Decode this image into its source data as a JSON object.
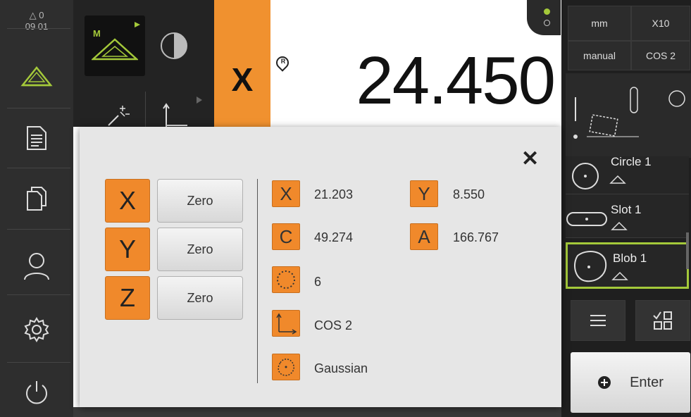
{
  "sidebar": {
    "warnings_count": "0",
    "time": "09 01",
    "items": [
      {
        "icon": "measure-triangle-icon"
      },
      {
        "icon": "document-list-icon"
      },
      {
        "icon": "files-icon"
      },
      {
        "icon": "user-icon"
      },
      {
        "icon": "settings-gear-icon"
      },
      {
        "icon": "power-icon"
      }
    ]
  },
  "toolbar": {
    "mode_badge": "M",
    "contrast_icon": "contrast-icon",
    "auto_icon": "magic-wand-icon",
    "coord_icon": "coordinate-axes-icon"
  },
  "dro": {
    "axis": "X",
    "ref_marker": "R",
    "value": "24.450"
  },
  "rightpanel": {
    "unit": "mm",
    "zoom": "X10",
    "mode": "manual",
    "coord_system": "COS 2",
    "features": [
      {
        "name": "Circle 1"
      },
      {
        "name": "Slot 1"
      },
      {
        "name": "Blob 1",
        "selected": true
      }
    ],
    "enter_label": "Enter"
  },
  "dialog": {
    "zero_rows": [
      {
        "axis": "X",
        "label": "Zero"
      },
      {
        "axis": "Y",
        "label": "Zero"
      },
      {
        "axis": "Z",
        "label": "Zero"
      }
    ],
    "values": {
      "x_label": "X",
      "x_value": "21.203",
      "y_label": "Y",
      "y_value": "8.550",
      "c_label": "C",
      "c_value": "49.274",
      "a_label": "A",
      "a_value": "166.767",
      "points_value": "6",
      "cos_value": "COS 2",
      "filter_value": "Gaussian"
    },
    "close_icon": "close-icon"
  },
  "colors": {
    "accent_orange": "#f0892b",
    "select_green": "#a4c93a",
    "sidebar_bg": "#2e2e2e"
  }
}
